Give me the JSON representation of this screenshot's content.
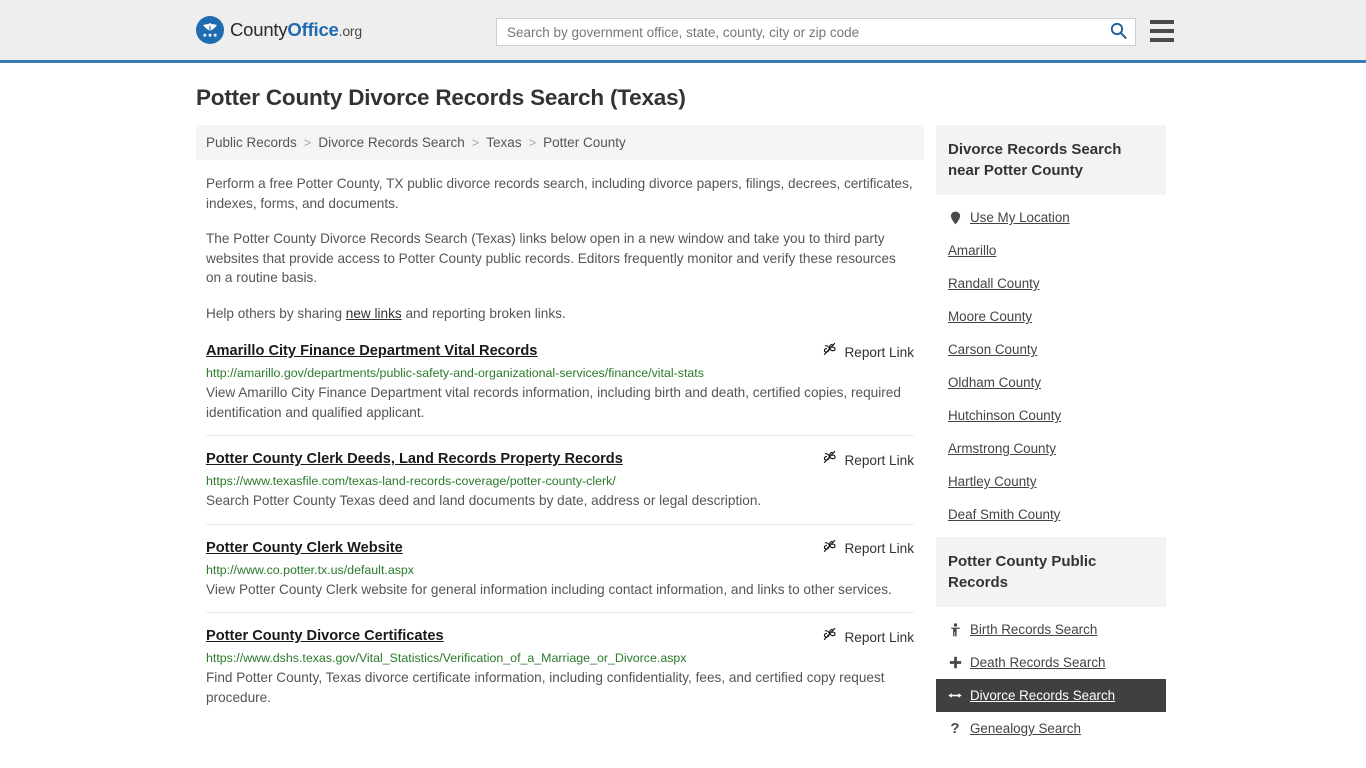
{
  "header": {
    "brand": {
      "part1": "County",
      "part2": "Office",
      "part3": ".org",
      "logo_icon": "eagle-stars-logo"
    },
    "search": {
      "placeholder": "Search by government office, state, county, city or zip code",
      "value": "",
      "search_icon": "search-icon"
    },
    "menu_icon": "hamburger-menu-icon",
    "accent_color": "#3a7ab0",
    "background_color": "#eeeeee"
  },
  "page": {
    "title": "Potter County Divorce Records Search (Texas)"
  },
  "breadcrumb": {
    "separator": ">",
    "items": [
      {
        "label": "Public Records"
      },
      {
        "label": "Divorce Records Search"
      },
      {
        "label": "Texas"
      },
      {
        "label": "Potter County"
      }
    ]
  },
  "intro": {
    "paragraph1": "Perform a free Potter County, TX public divorce records search, including divorce papers, filings, decrees, certificates, indexes, forms, and documents.",
    "paragraph2": "The Potter County Divorce Records Search (Texas) links below open in a new window and take you to third party websites that provide access to Potter County public records. Editors frequently monitor and verify these resources on a routine basis.",
    "share_prefix": "Help others by sharing ",
    "share_link": "new links",
    "share_suffix": " and reporting broken links."
  },
  "results": {
    "report_label": "Report Link",
    "report_icon": "unlink-icon",
    "items": [
      {
        "title": "Amarillo City Finance Department Vital Records",
        "url": "http://amarillo.gov/departments/public-safety-and-organizational-services/finance/vital-stats",
        "description": "View Amarillo City Finance Department vital records information, including birth and death, certified copies, required identification and qualified applicant."
      },
      {
        "title": "Potter County Clerk Deeds, Land Records Property Records",
        "url": "https://www.texasfile.com/texas-land-records-coverage/potter-county-clerk/",
        "description": "Search Potter County Texas deed and land documents by date, address or legal description."
      },
      {
        "title": "Potter County Clerk Website",
        "url": "http://www.co.potter.tx.us/default.aspx",
        "description": "View Potter County Clerk website for general information including contact information, and links to other services."
      },
      {
        "title": "Potter County Divorce Certificates",
        "url": "https://www.dshs.texas.gov/Vital_Statistics/Verification_of_a_Marriage_or_Divorce.aspx",
        "description": "Find Potter County, Texas divorce certificate information, including confidentiality, fees, and certified copy request procedure."
      }
    ]
  },
  "sidebar": {
    "nearby": {
      "heading": "Divorce Records Search near Potter County",
      "items": [
        {
          "label": "Use My Location",
          "icon": "map-pin-icon",
          "active": false
        },
        {
          "label": "Amarillo",
          "icon": "",
          "active": false
        },
        {
          "label": "Randall County",
          "icon": "",
          "active": false
        },
        {
          "label": "Moore County",
          "icon": "",
          "active": false
        },
        {
          "label": "Carson County",
          "icon": "",
          "active": false
        },
        {
          "label": "Oldham County",
          "icon": "",
          "active": false
        },
        {
          "label": "Hutchinson County",
          "icon": "",
          "active": false
        },
        {
          "label": "Armstrong County",
          "icon": "",
          "active": false
        },
        {
          "label": "Hartley County",
          "icon": "",
          "active": false
        },
        {
          "label": "Deaf Smith County",
          "icon": "",
          "active": false
        }
      ]
    },
    "public_records": {
      "heading": "Potter County Public Records",
      "items": [
        {
          "label": "Birth Records Search",
          "icon": "baby-icon",
          "active": false
        },
        {
          "label": "Death Records Search",
          "icon": "cross-icon",
          "active": false
        },
        {
          "label": "Divorce Records Search",
          "icon": "split-arrows-icon",
          "active": true
        },
        {
          "label": "Genealogy Search",
          "icon": "question-mark-icon",
          "active": false
        }
      ]
    }
  }
}
